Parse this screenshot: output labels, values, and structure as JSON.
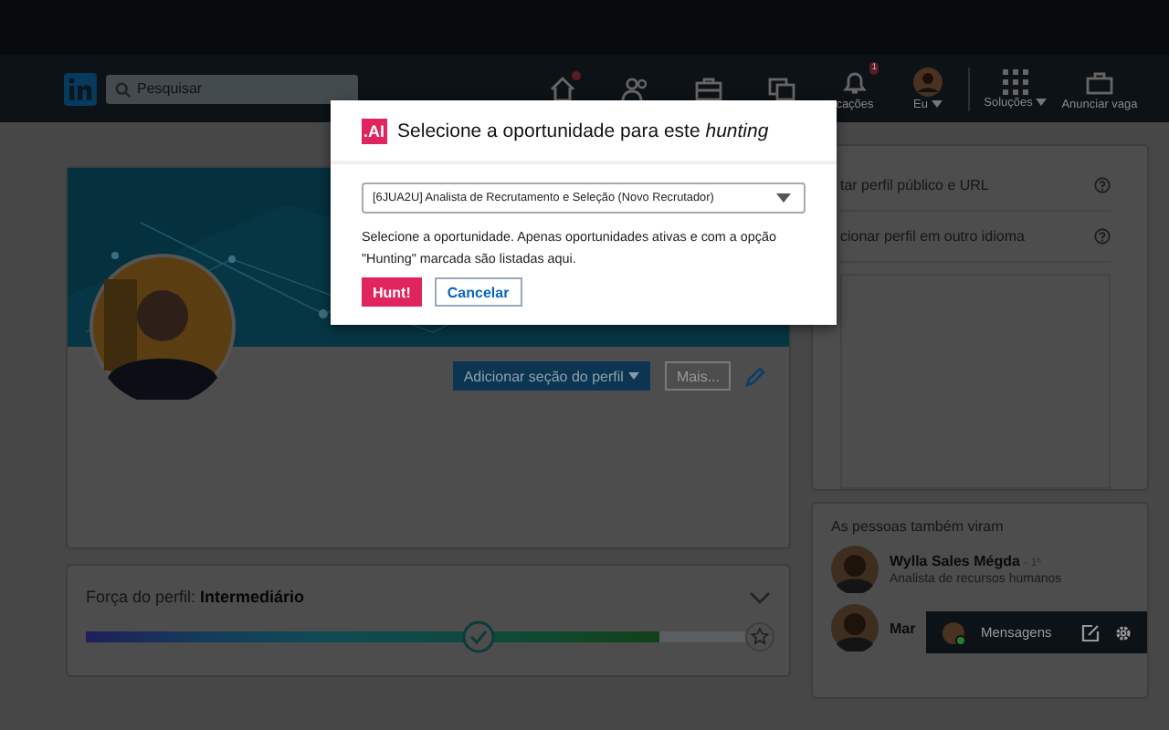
{
  "nav": {
    "search": {
      "placeholder": "Pesquisar"
    },
    "items": [
      {
        "kind": "home",
        "dot": true
      },
      {
        "kind": "network"
      },
      {
        "kind": "jobs"
      },
      {
        "kind": "messages"
      },
      {
        "kind": "bell",
        "label": "cações",
        "badge": "1"
      },
      {
        "kind": "me",
        "label": "Eu",
        "caret": true
      },
      {
        "kind": "grid",
        "label": "Soluções",
        "caret": true
      },
      {
        "kind": "post",
        "label": "Anunciar vaga"
      }
    ]
  },
  "profile": {
    "add_section": "Adicionar seção do perfil",
    "more": "Mais..."
  },
  "strength": {
    "label": "Força do perfil:",
    "value": "Intermediário",
    "level": 0.86
  },
  "side": {
    "links": [
      "tar perfil público e URL",
      "cionar perfil em outro idioma"
    ],
    "people_title": "As pessoas também viram",
    "people": [
      {
        "name": "Wylla Sales Mégda",
        "degree": "· 1º",
        "title": "Analista de recursos humanos"
      },
      {
        "name": "Mar"
      }
    ]
  },
  "messaging": {
    "label": "Mensagens"
  },
  "modal": {
    "title": "Selecione a oportunidade para este *hunting*",
    "logo": ".AI",
    "select": "[6JUA2U] Analista de Recrutamento e Seleção (Novo Recrutador)",
    "help": "Selecione a oportunidade. Apenas oportunidades ativas e com a opção \"Hunting\" marcada são listadas aqui.",
    "buttons": [
      {
        "label": "Hunt!",
        "kind": "primary"
      },
      {
        "label": "Cancelar",
        "kind": "secondary"
      }
    ]
  }
}
